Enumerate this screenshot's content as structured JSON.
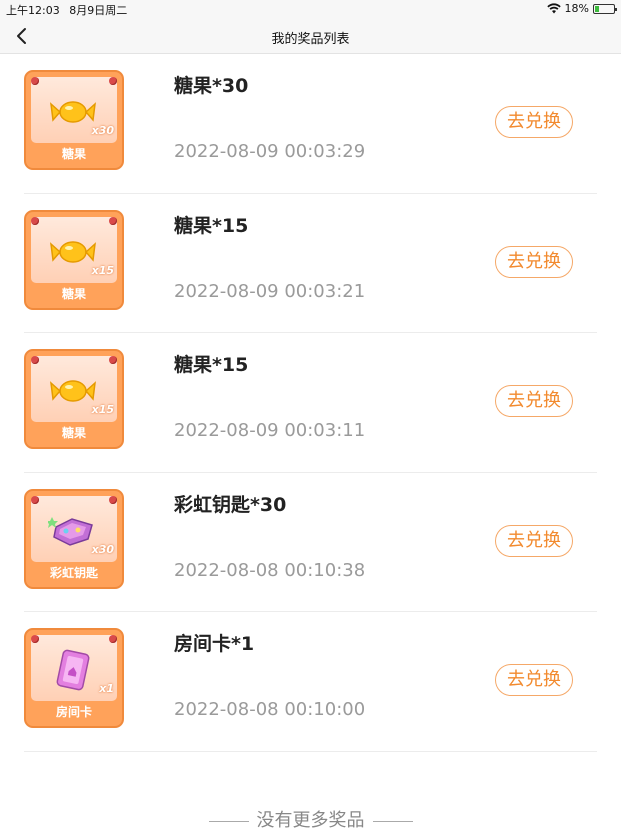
{
  "status_bar": {
    "time": "上午12:03",
    "date": "8月9日周二",
    "battery": "18%"
  },
  "nav": {
    "title": "我的奖品列表",
    "back_icon": "chevron-left-icon"
  },
  "prizes": [
    {
      "name": "糖果*30",
      "time": "2022-08-09 00:03:29",
      "thumb_label": "糖果",
      "thumb_qty": "x30",
      "icon": "candy-icon",
      "button": "去兑换"
    },
    {
      "name": "糖果*15",
      "time": "2022-08-09 00:03:21",
      "thumb_label": "糖果",
      "thumb_qty": "x15",
      "icon": "candy-icon",
      "button": "去兑换"
    },
    {
      "name": "糖果*15",
      "time": "2022-08-09 00:03:11",
      "thumb_label": "糖果",
      "thumb_qty": "x15",
      "icon": "candy-icon",
      "button": "去兑换"
    },
    {
      "name": "彩虹钥匙*30",
      "time": "2022-08-08 00:10:38",
      "thumb_label": "彩虹钥匙",
      "thumb_qty": "x30",
      "icon": "rainbow-key-icon",
      "button": "去兑换"
    },
    {
      "name": "房间卡*1",
      "time": "2022-08-08 00:10:00",
      "thumb_label": "房间卡",
      "thumb_qty": "x1",
      "icon": "room-card-icon",
      "button": "去兑换"
    }
  ],
  "footer": {
    "text": "没有更多奖品"
  },
  "colors": {
    "accent": "#f28a2e",
    "thumb_bg": "#ffa25a",
    "time_text": "#9a9a9a"
  }
}
